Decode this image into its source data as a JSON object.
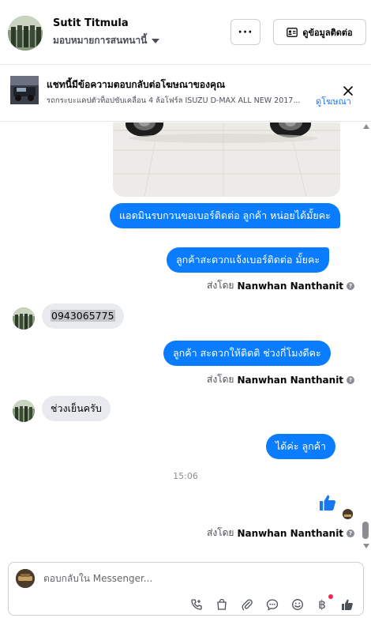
{
  "header": {
    "contact_name": "Sutit Titmula",
    "assignee_label": "มอบหมายการสนทนานี้",
    "more_label": "···",
    "contact_info_label": "ดูข้อมูลติดต่อ"
  },
  "ad_banner": {
    "title": "แชทนี้มีข้อความตอบกลับต่อโฆษณาของคุณ",
    "subtitle": "รถกระบะแคปตัวท็อปขับเคลื่อน 4 ล้อโฟร์ล ISUZU D-MAX ALL NEW 2017...",
    "link_label": "ดูโฆษณา"
  },
  "messages": [
    {
      "dir": "out",
      "text": "แอดมินรบกวนขอเบอร์ติดต่อ ลูกค้า หน่อยได้มั้ยคะ"
    },
    {
      "dir": "out",
      "text": "ลูกค้าสะดวกแจ้งเบอร์ติดต่อ มั้ยคะ"
    },
    {
      "dir": "in",
      "text": "0943065775"
    },
    {
      "dir": "out",
      "text": "ลูกค้า สะดวกให้ติดติ ช่วงกี่โมงดีคะ"
    },
    {
      "dir": "in",
      "text": "ช่วงเย็นครับ"
    },
    {
      "dir": "out",
      "text": "ได้ค่ะ  ลูกค้า"
    }
  ],
  "sent_by": {
    "prefix": "ส่งโดย",
    "name": "Nanwhan Nanthanit"
  },
  "timestamp": "15:06",
  "composer": {
    "placeholder": "ตอบกลับใน Messenger..."
  },
  "colors": {
    "outgoing_bubble": "#0a7cff",
    "incoming_bubble": "#e9eaed",
    "link": "#1877f2",
    "like": "#1877f2"
  }
}
